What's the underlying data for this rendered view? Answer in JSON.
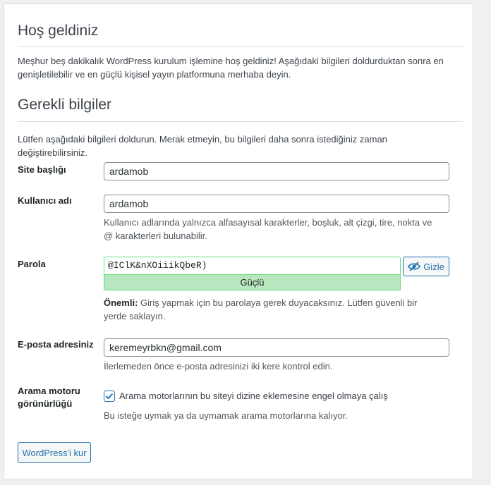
{
  "welcome": {
    "title": "Hoş geldiniz",
    "text": "Meşhur beş dakikalık WordPress kurulum işlemine hoş geldiniz! Aşağıdaki bilgileri doldurduktan sonra en genişletilebilir ve en güçlü kişisel yayın platformuna merhaba deyin."
  },
  "required": {
    "title": "Gerekli bilgiler",
    "text": "Lütfen aşağıdaki bilgileri doldurun. Merak etmeyin, bu bilgileri daha sonra istediğiniz zaman değiştirebilirsiniz."
  },
  "fields": {
    "site_title": {
      "label": "Site başlığı",
      "value": "ardamob"
    },
    "username": {
      "label": "Kullanıcı adı",
      "value": "ardamob",
      "description": "Kullanıcı adlarında yalnızca alfasayısal karakterler, boşluk, alt çizgi, tire, nokta ve @ karakterleri bulunabilir."
    },
    "password": {
      "label": "Parola",
      "value": "@IClK&nXOiiikQbeR)",
      "strength": "Güçlü",
      "hide_button": "Gizle",
      "important_label": "Önemli:",
      "important_text": " Giriş yapmak için bu parolaya gerek duyacaksınız. Lütfen güvenli bir yerde saklayın."
    },
    "email": {
      "label": "E-posta adresiniz",
      "value": "keremeyrbkn@gmail.com",
      "description": "İlerlemeden önce e-posta adresinizi iki kere kontrol edin."
    },
    "search_visibility": {
      "label_line1": "Arama motoru",
      "label_line2": "görünürlüğü",
      "checkbox_label": "Arama motorlarının bu siteyi dizine eklemesine engel olmaya çalış",
      "checked": true,
      "description": "Bu isteğe uymak ya da uymamak arama motorlarına kalıyor."
    }
  },
  "install_button": "WordPress'i kur",
  "colors": {
    "accent": "#2271b1",
    "strong_bg": "#b8e6bf",
    "strong_border": "#68de7c"
  },
  "icons": {
    "hide": "eye-slash-icon",
    "check": "checkmark-icon"
  }
}
